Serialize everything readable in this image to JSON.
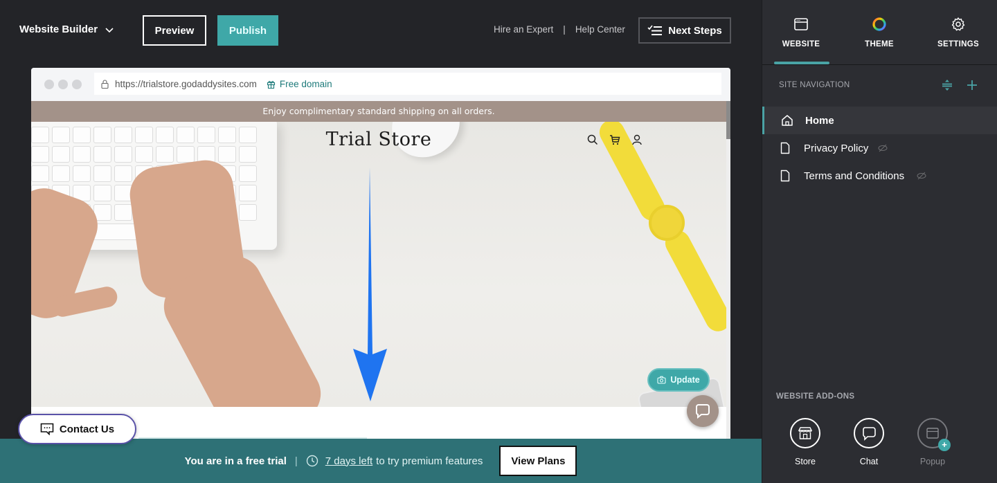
{
  "topbar": {
    "brand": "Website Builder",
    "preview_label": "Preview",
    "publish_label": "Publish",
    "hire_expert": "Hire an Expert",
    "link_separator": "|",
    "help_center": "Help Center",
    "next_steps_label": "Next Steps"
  },
  "browser": {
    "url": "https://trialstore.godaddysites.com",
    "free_domain": "Free domain"
  },
  "site": {
    "announcement": "Enjoy complimentary standard shipping on all orders.",
    "title": "Trial Store",
    "icons": [
      "search-icon",
      "cart-icon",
      "account-icon"
    ],
    "update_label": "Update"
  },
  "contact": {
    "label": "Contact Us"
  },
  "trial_banner": {
    "status": "You are in a free trial",
    "separator": "|",
    "days_left": "7 days left",
    "rest": "to try premium features",
    "view_plans_label": "View Plans"
  },
  "panel": {
    "tabs": [
      {
        "label": "WEBSITE",
        "icon": "browser-window-icon",
        "active": true
      },
      {
        "label": "THEME",
        "icon": "color-wheel-icon",
        "active": false
      },
      {
        "label": "SETTINGS",
        "icon": "gear-icon",
        "active": false
      }
    ],
    "site_navigation_label": "SITE NAVIGATION",
    "nav_items": [
      {
        "label": "Home",
        "icon": "home-icon",
        "active": true,
        "hidden": false
      },
      {
        "label": "Privacy Policy",
        "icon": "page-icon",
        "active": false,
        "hidden": true
      },
      {
        "label": "Terms and Conditions",
        "icon": "page-icon",
        "active": false,
        "hidden": true
      }
    ],
    "addons_label": "WEBSITE ADD-ONS",
    "addons": [
      {
        "label": "Store",
        "icon": "store-icon",
        "enabled": true
      },
      {
        "label": "Chat",
        "icon": "chat-icon",
        "enabled": true
      },
      {
        "label": "Popup",
        "icon": "popup-icon",
        "enabled": false
      }
    ]
  },
  "colors": {
    "accent": "#3fa8a8",
    "trial_banner": "#2e7176",
    "announcement_bar": "#a39289",
    "panel_bg": "#2c2d32",
    "app_bg": "#232428",
    "arrow": "#1f74f0"
  }
}
